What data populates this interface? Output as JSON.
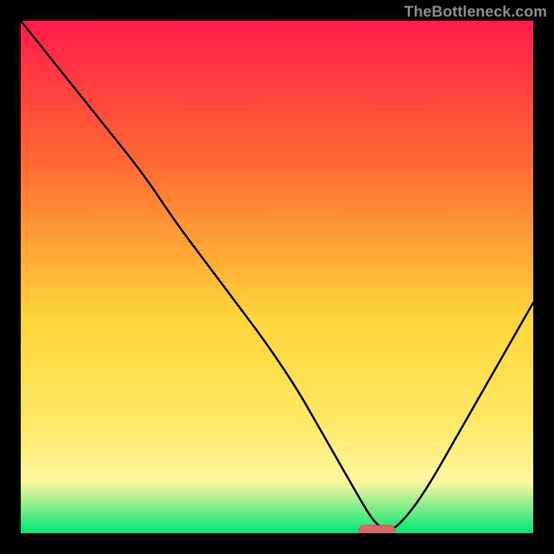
{
  "watermark": "TheBottleneck.com",
  "colors": {
    "background": "#000000",
    "gradient_top": "#ff1a4a",
    "gradient_mid1": "#ff6a33",
    "gradient_mid2": "#ffd53a",
    "gradient_mid3": "#ffe864",
    "gradient_mid4": "#fff6a0",
    "gradient_bottom": "#00e676",
    "curve": "#000000",
    "marker_fill": "#e06666",
    "marker_stroke": "#c44d4d"
  },
  "chart_data": {
    "type": "line",
    "title": "",
    "xlabel": "",
    "ylabel": "",
    "xlim": [
      0,
      100
    ],
    "ylim": [
      0,
      100
    ],
    "annotations": [],
    "series": [
      {
        "name": "bottleneck-curve",
        "x": [
          0,
          8,
          16,
          24,
          30,
          36,
          42,
          48,
          54,
          58,
          62,
          66,
          69,
          72,
          76,
          80,
          84,
          88,
          92,
          96,
          100
        ],
        "values": [
          100,
          90,
          80,
          70,
          61,
          53,
          45,
          37,
          28,
          21,
          14,
          7,
          2,
          0,
          4,
          10,
          17,
          24,
          31,
          38,
          45
        ]
      }
    ],
    "marker": {
      "x_start": 66,
      "x_end": 73,
      "y": 0.6
    }
  }
}
